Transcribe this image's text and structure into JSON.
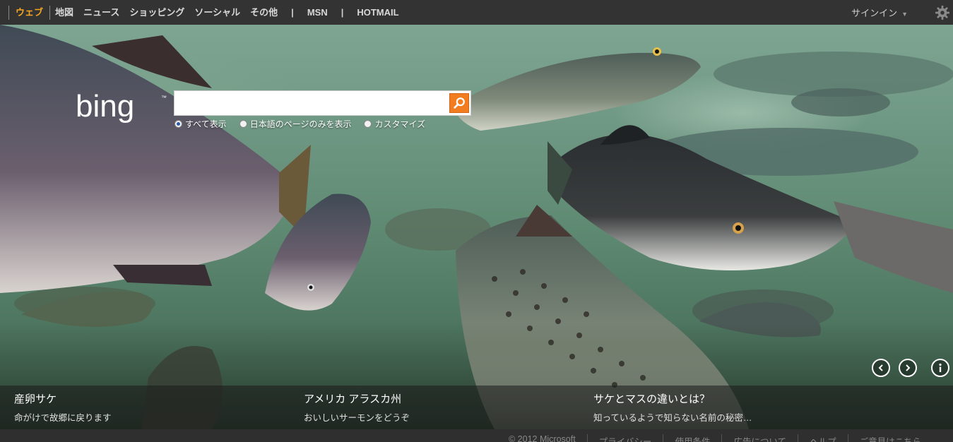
{
  "nav": {
    "items": [
      "ウェブ",
      "地図",
      "ニュース",
      "ショッピング",
      "ソーシャル",
      "その他"
    ],
    "extra": [
      "MSN",
      "HOTMAIL"
    ],
    "separator": "|",
    "signin": "サインイン"
  },
  "search": {
    "value": "",
    "scopes": [
      "すべて表示",
      "日本語のページのみを表示",
      "カスタマイズ"
    ]
  },
  "captions": [
    {
      "title": "産卵サケ",
      "subtitle": "命がけで故郷に戻ります"
    },
    {
      "title": "アメリカ アラスカ州",
      "subtitle": "おいしいサーモンをどうぞ"
    },
    {
      "title": "サケとマスの違いとは？",
      "subtitle": "知っているようで知らない名前の秘密…"
    }
  ],
  "footer": {
    "links": [
      "© 2012 Microsoft",
      "プライバシー",
      "使用条件",
      "広告について",
      "ヘルプ",
      "ご意見はこちら"
    ]
  },
  "colors": {
    "accent": "#f5a623",
    "search_button": "#f27d20",
    "topbar": "#333333"
  },
  "icons": [
    "gear-icon",
    "search-icon",
    "prev-arrow-icon",
    "next-arrow-icon",
    "info-icon"
  ]
}
